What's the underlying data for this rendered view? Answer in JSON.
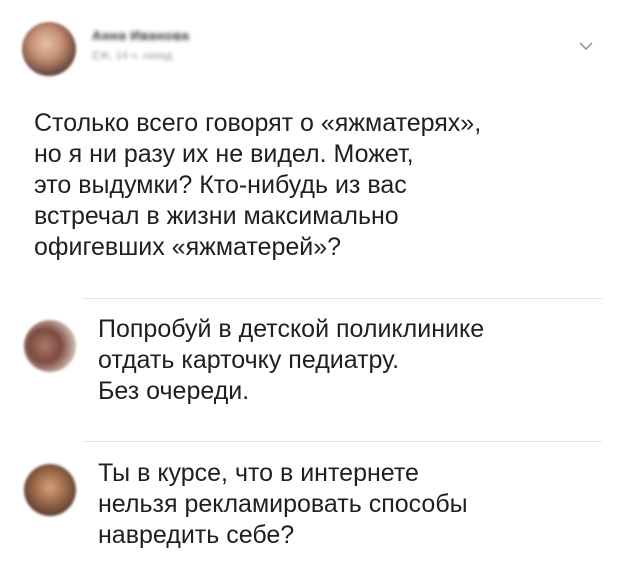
{
  "post": {
    "author_name": "Анна Иванова",
    "author_meta": "ЕЖ, 14 ч. назад",
    "text": "Столько всего говорят о «яжматерях»,\nно я ни разу их не видел. Может,\nэто выдумки? Кто-нибудь из вас\nвстречал в жизни максимально\nофигевших «яжматерей»?"
  },
  "comments": [
    {
      "text": "Попробуй в детской поликлинике\nотдать карточку педиатру.\nБез очереди."
    },
    {
      "text": "Ты в курсе, что в интернете\nнельзя рекламировать способы\nнавредить себе?"
    }
  ],
  "icons": {
    "menu": "chevron-down-icon"
  }
}
